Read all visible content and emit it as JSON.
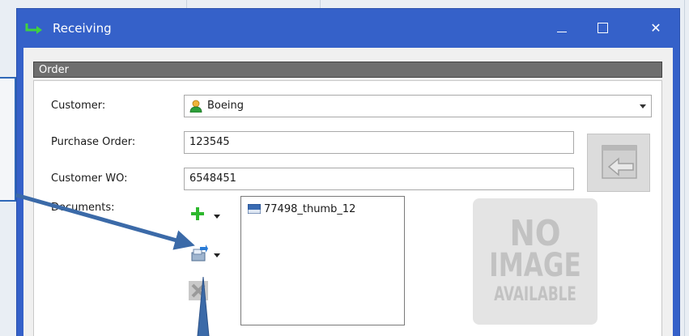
{
  "window": {
    "title": "Receiving",
    "controls": {
      "minimize": "minimize",
      "maximize": "maximize",
      "close": "✕"
    }
  },
  "section": {
    "title": "Order"
  },
  "form": {
    "customer": {
      "label": "Customer:",
      "value": "Boeing"
    },
    "purchase_order": {
      "label": "Purchase Order:",
      "value": "123545"
    },
    "customer_wo": {
      "label": "Customer WO:",
      "value": "6548451"
    },
    "documents": {
      "label": "Documents:",
      "items": [
        "77498_thumb_12"
      ]
    }
  },
  "preview": {
    "line1": "NO",
    "line2": "IMAGE",
    "line3": "AVAILABLE"
  },
  "icons": {
    "title": "receiving-arrow-icon",
    "customer": "person-icon",
    "lookup": "import-arrow-icon",
    "add": "plus-icon",
    "scan": "scan-import-icon",
    "delete": "delete-icon",
    "doc": "image-file-icon"
  },
  "colors": {
    "titlebar": "#3561c9",
    "header": "#6e6e6e",
    "callout": "#3b6aa8",
    "add": "#2db82d"
  }
}
